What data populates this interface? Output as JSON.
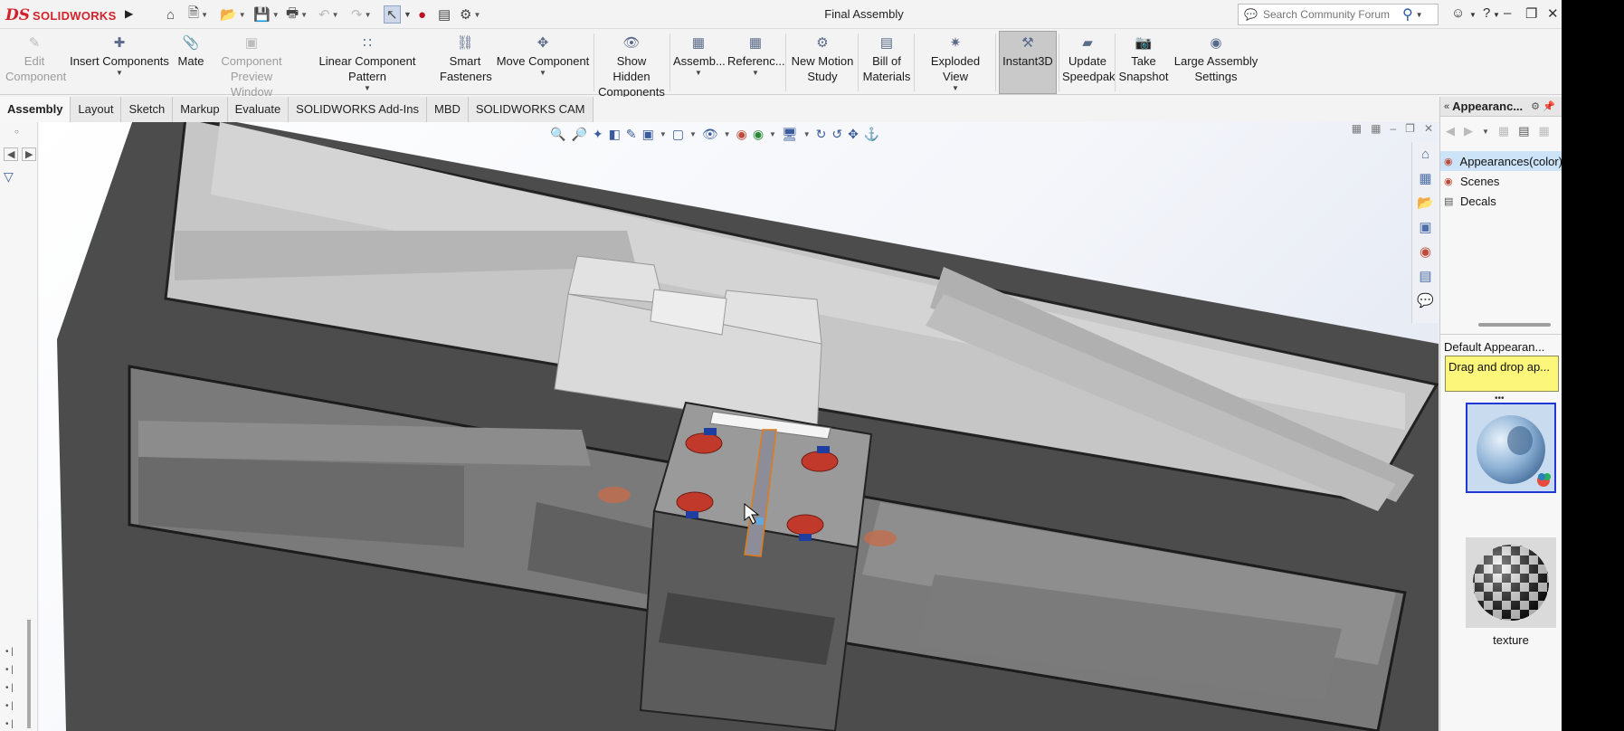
{
  "app": {
    "brand_prefix": "DS",
    "brand_name": "SOLIDWORKS"
  },
  "titlebar": {
    "doc_title": "Final Assembly",
    "search_placeholder": "Search Community Forum"
  },
  "ribbon": {
    "edit_component": "Edit Component",
    "insert_components": "Insert Components",
    "mate": "Mate",
    "component_preview_window": "Component Preview Window",
    "linear_component_pattern": "Linear Component Pattern",
    "smart_fasteners": "Smart Fasteners",
    "move_component": "Move Component",
    "show_hidden_components": "Show Hidden Components",
    "assembly": "Assemb...",
    "reference": "Referenc...",
    "new_motion_study": "New Motion Study",
    "bill_of_materials": "Bill of Materials",
    "exploded_view": "Exploded View",
    "instant3d": "Instant3D",
    "update_speedpak": "Update Speedpak",
    "take_snapshot": "Take Snapshot",
    "large_assembly_settings": "Large Assembly Settings"
  },
  "tabs": [
    "Assembly",
    "Layout",
    "Sketch",
    "Markup",
    "Evaluate",
    "SOLIDWORKS Add-Ins",
    "MBD",
    "SOLIDWORKS CAM"
  ],
  "taskpane": {
    "title": "Appearanc...",
    "tree": [
      "Appearances(color)",
      "Scenes",
      "Decals"
    ],
    "default_label": "Default Appearan...",
    "tooltip": "Drag and drop ap...",
    "swatch2_label": "texture"
  },
  "colors": {
    "brand_red": "#d2232a",
    "accent_blue": "#2038d8",
    "tooltip_yellow": "#fcf77a",
    "selection_blue": "#cde3f7"
  }
}
